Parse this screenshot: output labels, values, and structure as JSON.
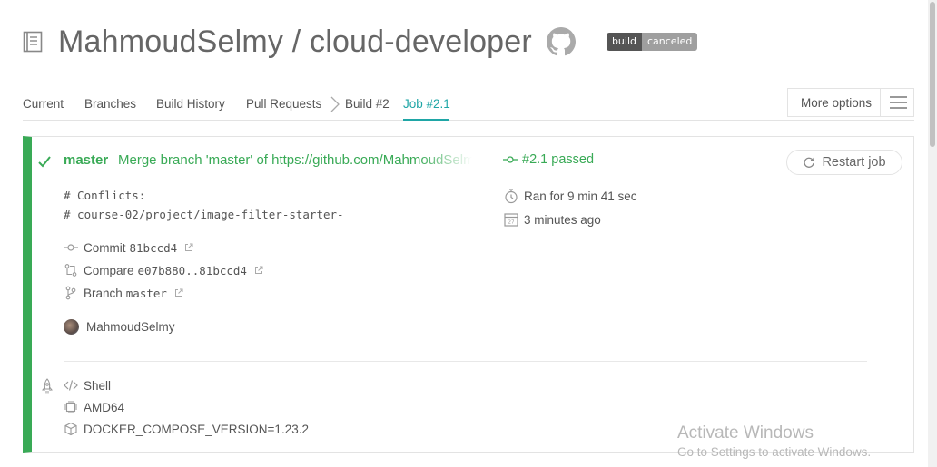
{
  "repo": {
    "title": "MahmoudSelmy / cloud-developer",
    "badge_left": "build",
    "badge_right": "canceled"
  },
  "tabs": {
    "items": [
      {
        "label": "Current"
      },
      {
        "label": "Branches"
      },
      {
        "label": "Build History"
      },
      {
        "label": "Pull Requests"
      },
      {
        "label": "Build #2"
      },
      {
        "label": "Job #2.1"
      }
    ],
    "active": "Job #2.1",
    "more_options": "More options"
  },
  "job": {
    "branch": "master",
    "commit_message": "Merge branch 'master' of https://github.com/MahmoudSelmy/cloud-developer",
    "status": "#2.1 passed",
    "restart_label": "Restart job",
    "conflicts": [
      "# Conflicts:",
      "# course-02/project/image-filter-starter-"
    ],
    "commit_label": "Commit",
    "commit_sha": "81bccd4",
    "compare_label": "Compare",
    "compare_range": "e07b880..81bccd4",
    "branch_label": "Branch",
    "branch_value": "master",
    "author": "MahmoudSelmy",
    "duration": "Ran for 9 min 41 sec",
    "finished": "3 minutes ago",
    "language": "Shell",
    "arch": "AMD64",
    "env_var": "DOCKER_COMPOSE_VERSION=1.23.2",
    "status_color": "#39aa56"
  },
  "watermark": {
    "title": "Activate Windows",
    "subtitle": "Go to Settings to activate Windows."
  },
  "colors": {
    "accent": "#1fa6a6",
    "passed": "#39aa56",
    "badge_dark": "#555555",
    "badge_light": "#9f9f9f"
  }
}
